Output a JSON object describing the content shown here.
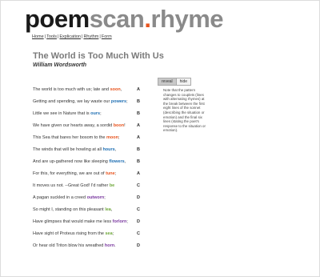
{
  "logo": {
    "part1": "poem",
    "part2": "scan",
    "dot": ".",
    "part3": "rhyme"
  },
  "nav": {
    "items": [
      "Home",
      "Tools",
      "Explication",
      "Rhythm",
      "Form"
    ],
    "separator": "|"
  },
  "poem": {
    "title": "The World is Too Much With Us",
    "author": "William Wordsworth"
  },
  "toggle": {
    "reveal": "reveal",
    "hide": "hide"
  },
  "note": "Note that the pattern changes to couplets (lines with alternating rhymes) at the break between the first eight lines of the sonnet (describing the situation or emotion) and the final six lines (stating the poet's response to the situation or emotion).",
  "lines": [
    {
      "pre": "The world is too much with us; late and ",
      "rw": "soon",
      "post": ",",
      "scheme": "A",
      "color": "#e8541e"
    },
    {
      "pre": "Getting and spending, we lay waste our ",
      "rw": "powers",
      "post": ";",
      "scheme": "B",
      "color": "#1f6fb3"
    },
    {
      "pre": "Little we see in Nature that is ",
      "rw": "ours",
      "post": ";",
      "scheme": "B",
      "color": "#1f6fb3"
    },
    {
      "pre": "We have given our hearts away, a sordid ",
      "rw": "boon",
      "post": "!",
      "scheme": "A",
      "color": "#e8541e"
    },
    {
      "pre": "This Sea that bares her bosom to the ",
      "rw": "moon",
      "post": ";",
      "scheme": "A",
      "color": "#e8541e"
    },
    {
      "pre": "The winds that will be howling at all ",
      "rw": "hours",
      "post": ",",
      "scheme": "B",
      "color": "#1f6fb3"
    },
    {
      "pre": "And are up-gathered now like sleeping ",
      "rw": "flowers",
      "post": ",",
      "scheme": "B",
      "color": "#1f6fb3"
    },
    {
      "pre": "For this, for everything, we are out of ",
      "rw": "tune",
      "post": ";",
      "scheme": "A",
      "color": "#e8541e"
    },
    {
      "pre": "It moves us not. --Great God! I'd rather ",
      "rw": "be",
      "post": "",
      "scheme": "C",
      "color": "#6fa83a"
    },
    {
      "pre": "A pagan suckled in a creed ",
      "rw": "outworn",
      "post": ";",
      "scheme": "D",
      "color": "#7b3aa0"
    },
    {
      "pre": "So might I, standing on this pleasant ",
      "rw": "lea",
      "post": ",",
      "scheme": "C",
      "color": "#6fa83a"
    },
    {
      "pre": "Have glimpses that would make me less ",
      "rw": "forlorn",
      "post": ";",
      "scheme": "D",
      "color": "#7b3aa0"
    },
    {
      "pre": "Have sight of Proteus rising from the ",
      "rw": "sea",
      "post": ";",
      "scheme": "C",
      "color": "#6fa83a"
    },
    {
      "pre": "Or hear old Triton blow his wreathed ",
      "rw": "horn",
      "post": ".",
      "scheme": "D",
      "color": "#7b3aa0"
    }
  ]
}
